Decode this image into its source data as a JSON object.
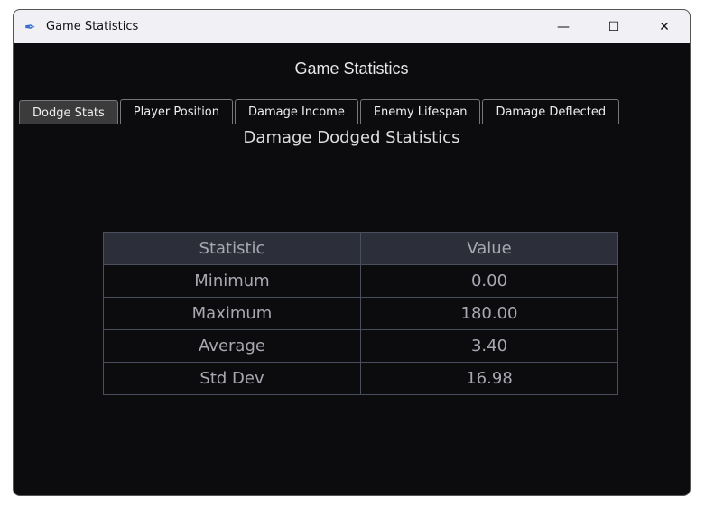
{
  "window": {
    "title": "Game Statistics"
  },
  "header": {
    "title": "Game Statistics"
  },
  "tabs": [
    {
      "label": "Dodge Stats"
    },
    {
      "label": "Player Position"
    },
    {
      "label": "Damage Income"
    },
    {
      "label": "Enemy Lifespan"
    },
    {
      "label": "Damage Deflected"
    }
  ],
  "panel": {
    "title": "Damage Dodged Statistics",
    "columns": [
      "Statistic",
      "Value"
    ],
    "rows": [
      [
        "Minimum",
        "0.00"
      ],
      [
        "Maximum",
        "180.00"
      ],
      [
        "Average",
        "3.40"
      ],
      [
        "Std Dev",
        "16.98"
      ]
    ]
  }
}
